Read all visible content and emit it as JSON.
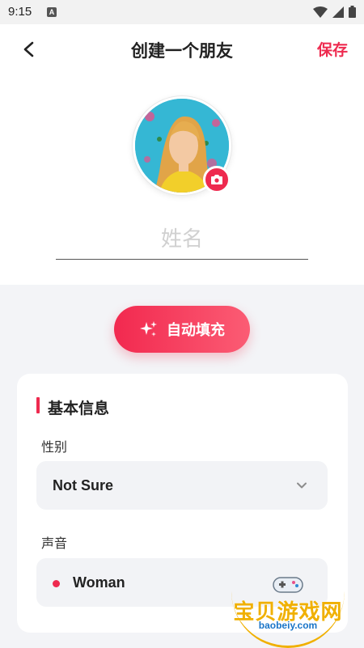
{
  "status": {
    "time": "9:15",
    "app_badge": "A"
  },
  "header": {
    "title": "创建一个朋友",
    "save_label": "保存"
  },
  "profile": {
    "name_placeholder": "姓名",
    "name_value": ""
  },
  "autofill": {
    "label": "自动填充"
  },
  "basic_info": {
    "title": "基本信息",
    "gender": {
      "label": "性别",
      "value": "Not Sure"
    },
    "voice": {
      "label": "声音",
      "value": "Woman"
    }
  },
  "watermark": {
    "text": "宝贝游戏网",
    "url": "baobeiy.com"
  },
  "colors": {
    "accent": "#ee2a4f",
    "background": "#f3f4f7"
  },
  "icons": [
    "back-arrow-icon",
    "camera-icon",
    "sparkle-icon",
    "chevron-down-icon",
    "wifi-icon",
    "signal-icon",
    "battery-icon"
  ]
}
